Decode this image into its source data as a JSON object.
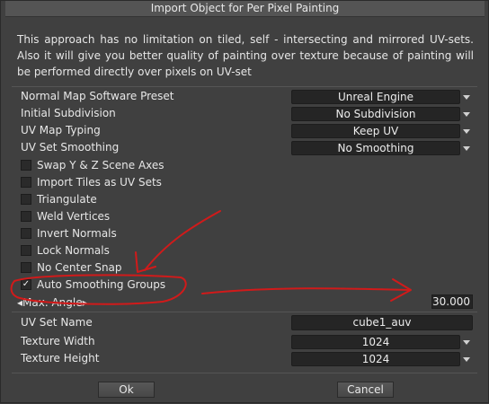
{
  "window": {
    "title": "Import Object for Per Pixel Painting",
    "description": "This approach has no limitation on tiled, self - intersecting and mirrored UV-sets. Also it will give you better quality of painting over texture because of painting will be performed directly over pixels on UV-set"
  },
  "dropdowns": [
    {
      "label": "Normal Map Software Preset",
      "value": "Unreal Engine"
    },
    {
      "label": "Initial Subdivision",
      "value": "No Subdivision"
    },
    {
      "label": "UV Map Typing",
      "value": "Keep UV"
    },
    {
      "label": "UV Set Smoothing",
      "value": "No Smoothing"
    }
  ],
  "checkboxes": [
    {
      "label": "Swap Y & Z Scene Axes",
      "checked": false
    },
    {
      "label": "Import Tiles as UV Sets",
      "checked": false
    },
    {
      "label": "Triangulate",
      "checked": false
    },
    {
      "label": "Weld Vertices",
      "checked": false
    },
    {
      "label": "Invert Normals",
      "checked": false
    },
    {
      "label": "Lock Normals",
      "checked": false
    },
    {
      "label": "No Center Snap",
      "checked": false
    },
    {
      "label": "Auto Smoothing Groups",
      "checked": true
    }
  ],
  "check_mark": "✓",
  "max_angle": {
    "label": "◂Max. Angle▸",
    "value": "30.000"
  },
  "uv_set_name": {
    "label": "UV Set Name",
    "value": "cube1_auv"
  },
  "texture_width": {
    "label": "Texture Width",
    "value": "1024"
  },
  "texture_height": {
    "label": "Texture Height",
    "value": "1024"
  },
  "buttons": {
    "ok": "Ok",
    "cancel": "Cancel"
  },
  "colors": {
    "annotation": "#d11a1a",
    "background": "#404040",
    "field": "#252525"
  }
}
